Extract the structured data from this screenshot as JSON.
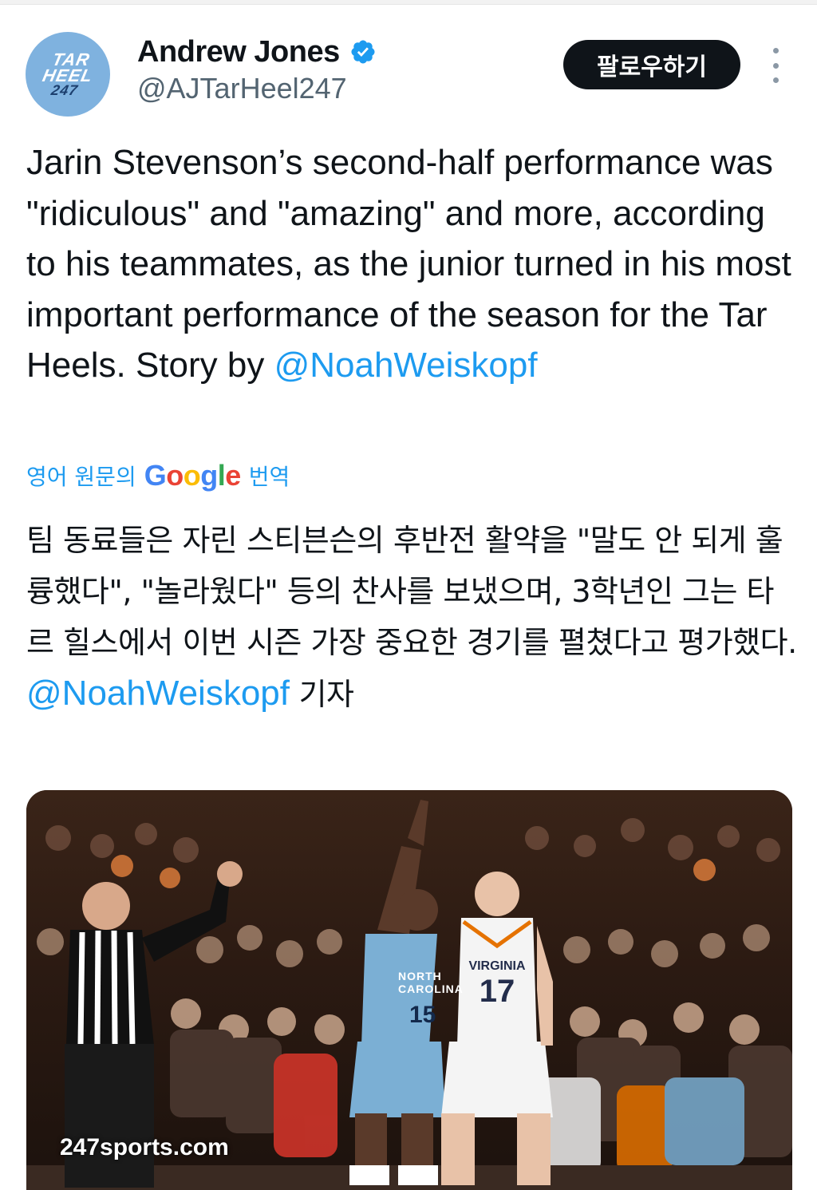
{
  "author": {
    "display_name": "Andrew Jones",
    "handle": "@AJTarHeel247",
    "avatar_logo": [
      "TAR",
      "HEEL",
      "247"
    ],
    "verified": true
  },
  "follow_label": "팔로우하기",
  "tweet": {
    "text": "Jarin Stevenson’s second-half performance was \"ridiculous\" and \"amazing\" and more, according to his teammates, as the junior turned in his most important performance of the season for the Tar Heels. Story by ",
    "mention": "@NoahWeiskopf"
  },
  "translation": {
    "prefix": "영어 원문의",
    "brand": [
      "G",
      "o",
      "o",
      "g",
      "l",
      "e"
    ],
    "suffix": "번역",
    "text": "팀 동료들은 자린 스티븐슨의 후반전 활약을 \"말도 안 되게 훌륭했다\", \"놀라웠다\" 등의 찬사를 보냈으며, 3학년인 그는 타르 힐스에서 이번 시즌 가장 중요한 경기를 펼쳤다고 평가했다. ",
    "mention": "@NoahWeiskopf",
    "after": " 기자"
  },
  "media": {
    "watermark": "247sports.com",
    "jersey_left_team": "NORTH CAROLINA",
    "jersey_left_number": "15",
    "jersey_right_team": "VIRGINIA",
    "jersey_right_number": "17"
  },
  "colors": {
    "link": "#1d9bf0",
    "text": "#0f1419",
    "secondary": "#536471",
    "verified": "#1d9bf0",
    "carolina_blue": "#7bafd4",
    "virginia_orange": "#e57200"
  },
  "icons": [
    "verified-badge-icon",
    "more-options-icon"
  ]
}
